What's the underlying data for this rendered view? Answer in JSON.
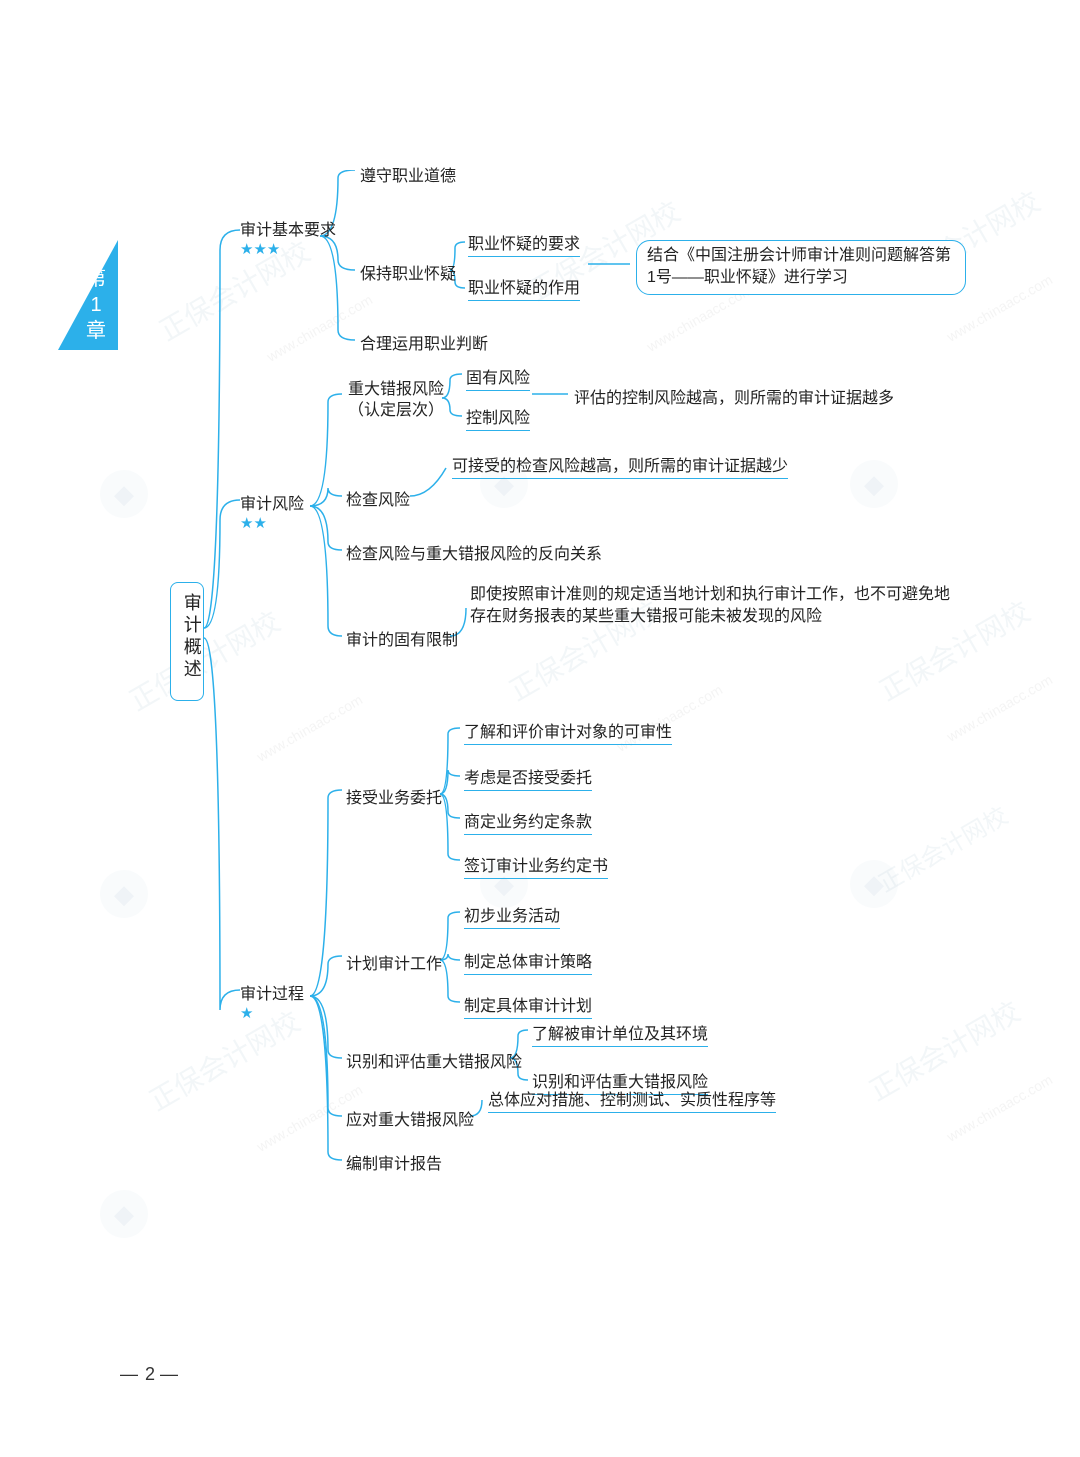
{
  "chapter_tab": {
    "line1": "第",
    "line2": "1",
    "line3": "章"
  },
  "star_full": "★",
  "star_empty": "",
  "root": "审计概述",
  "level1": {
    "basic": {
      "label": "审计基本要求",
      "stars": "★★★"
    },
    "risk": {
      "label": "审计风险",
      "stars": "★★"
    },
    "process": {
      "label": "审计过程",
      "stars": "★"
    }
  },
  "basic_children": {
    "ethics": "遵守职业道德",
    "skepticism": "保持职业怀疑",
    "skepticism_sub": {
      "req": "职业怀疑的要求",
      "effect": "职业怀疑的作用"
    },
    "skepticism_note": "结合《中国注册会计师审计准则问题解答第1号——职业怀疑》进行学习",
    "judgment": "合理运用职业判断"
  },
  "risk_children": {
    "material_misstatement": "重大错报风险（认定层次）",
    "mm_sub": {
      "inherent": "固有风险",
      "control": "控制风险"
    },
    "mm_note": "评估的控制风险越高，则所需的审计证据越多",
    "detection": "检查风险",
    "detection_note": "可接受的检查风险越高，则所需的审计证据越少",
    "inverse": "检查风险与重大错报风险的反向关系",
    "inherent_limit": "审计的固有限制",
    "inherent_limit_note": "即使按照审计准则的规定适当地计划和执行审计工作，也不可避免地存在财务报表的某些重大错报可能未被发现的风险"
  },
  "process_children": {
    "accept": "接受业务委托",
    "accept_sub": {
      "s1": "了解和评价审计对象的可审性",
      "s2": "考虑是否接受委托",
      "s3": "商定业务约定条款",
      "s4": "签订审计业务约定书"
    },
    "plan": "计划审计工作",
    "plan_sub": {
      "s1": "初步业务活动",
      "s2": "制定总体审计策略",
      "s3": "制定具体审计计划"
    },
    "identify": "识别和评估重大错报风险",
    "identify_sub": {
      "s1": "了解被审计单位及其环境",
      "s2": "识别和评估重大错报风险"
    },
    "respond": "应对重大错报风险",
    "respond_sub": "总体应对措施、控制测试、实质性程序等",
    "report": "编制审计报告"
  },
  "page_number": "2",
  "watermark_text": "正保会计网校",
  "watermark_url": "www.chinaacc.com"
}
